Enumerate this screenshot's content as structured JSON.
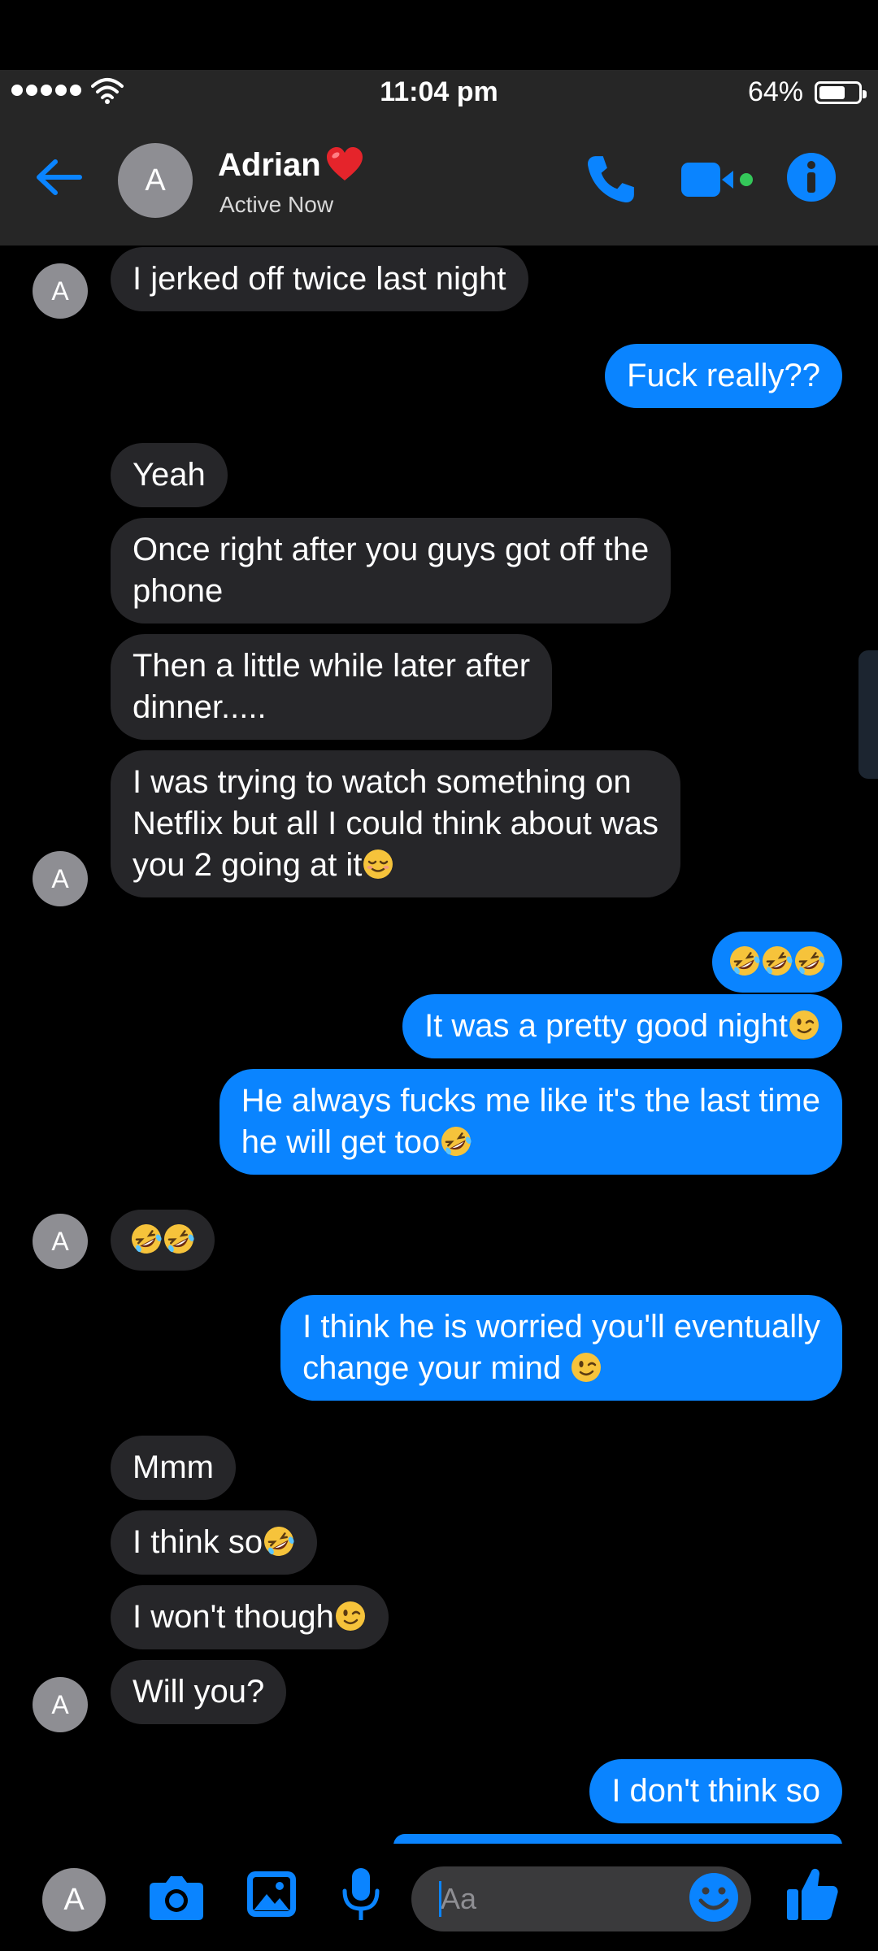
{
  "status_bar": {
    "time": "11:04 pm",
    "battery": "64%"
  },
  "header": {
    "name": "Adrian",
    "status": "Active Now",
    "avatar_letter": "A"
  },
  "colors": {
    "accent": "#0a84ff",
    "incoming_bubble": "#262629",
    "header_bg": "#262626",
    "video_dot": "#34c759"
  },
  "messages": [
    {
      "text": "I jerked off twice last night"
    },
    {
      "text": "Fuck really??"
    },
    {
      "text": "Yeah"
    },
    {
      "text": "Once right after you guys got off the\nphone"
    },
    {
      "text": "Then a little while later after\ndinner....."
    },
    {
      "text": "I was trying to watch something on\nNetflix but all I could think about was\nyou 2 going at it"
    },
    {
      "text": ""
    },
    {
      "text": "It was a pretty good night"
    },
    {
      "text": "He always fucks me like it's the last time\nhe will get too"
    },
    {
      "text": ""
    },
    {
      "text": "I think he is worried you'll eventually\nchange your mind "
    },
    {
      "text": "Mmm"
    },
    {
      "text": "I think so"
    },
    {
      "text": "I won't though"
    },
    {
      "text": "Will you?"
    },
    {
      "text": "I don't think so"
    }
  ],
  "composer": {
    "placeholder": "Aa",
    "avatar_letter": "A"
  },
  "icons": [
    "back-arrow-icon",
    "phone-icon",
    "video-camera-icon",
    "info-icon",
    "camera-icon",
    "gallery-icon",
    "microphone-icon",
    "smiley-icon",
    "thumbs-up-icon",
    "heart-emoji",
    "rofl-emoji",
    "relieved-emoji",
    "wink-emoji"
  ]
}
